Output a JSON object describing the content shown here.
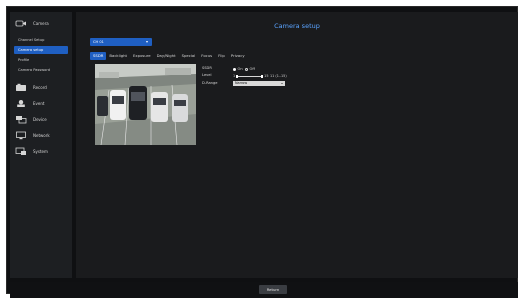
{
  "sidebar": {
    "items": [
      {
        "label": "Camera",
        "icon": "camera-icon"
      },
      {
        "label": "Record",
        "icon": "record-icon"
      },
      {
        "label": "Event",
        "icon": "event-icon"
      },
      {
        "label": "Device",
        "icon": "device-icon"
      },
      {
        "label": "Network",
        "icon": "network-icon"
      },
      {
        "label": "System",
        "icon": "system-icon"
      }
    ],
    "sub_items": [
      {
        "label": "Channel Setup",
        "active": false
      },
      {
        "label": "Camera setup",
        "active": true
      },
      {
        "label": "Profile",
        "active": false
      },
      {
        "label": "Camera Password",
        "active": false
      }
    ]
  },
  "main": {
    "title": "Camera setup",
    "channel_select": "CH 01",
    "tabs": [
      {
        "label": "SSDR",
        "active": true
      },
      {
        "label": "Backlight",
        "active": false
      },
      {
        "label": "Exposure",
        "active": false
      },
      {
        "label": "Day/Night",
        "active": false
      },
      {
        "label": "Special",
        "active": false
      },
      {
        "label": "Focus",
        "active": false
      },
      {
        "label": "Flip",
        "active": false
      },
      {
        "label": "Privacy",
        "active": false
      }
    ],
    "form": {
      "ssdr_label": "SSDR",
      "ssdr_on": "On",
      "ssdr_off": "Off",
      "ssdr_value": "On",
      "level_label": "Level",
      "level_min_label": "1",
      "level_max_label": "15",
      "level_value_text": "11 (1..15)",
      "level_value": 11,
      "drange_label": "D-Range",
      "drange_value": "Narrow"
    }
  },
  "footer": {
    "return_label": "Return"
  },
  "colors": {
    "accent": "#1f5fc2",
    "title": "#5aa3ff",
    "background": "#1a1b1d",
    "sidebar": "#1d1f22"
  }
}
